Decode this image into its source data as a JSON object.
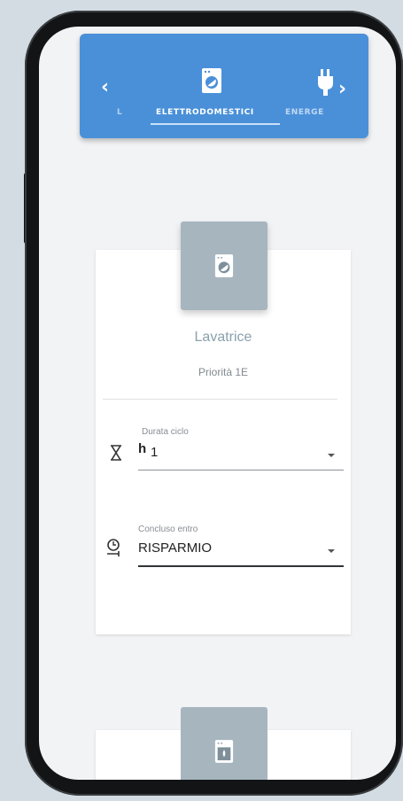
{
  "header": {
    "left_arrow": "‹",
    "right_arrow": "›",
    "tabs": [
      {
        "label": "L"
      },
      {
        "label": "ELETTRODOMESTICI",
        "active": true
      },
      {
        "label": "ENERGE"
      }
    ],
    "active_icon": "washing-machine-icon",
    "right_icon": "plug-icon"
  },
  "appliance": {
    "name": "Lavatrice",
    "priority": "Priorità 1E",
    "icon": "washing-machine-icon"
  },
  "fields": {
    "duration": {
      "label": "Durata ciclo",
      "prefix": "h",
      "value": "1",
      "icon": "hourglass-icon"
    },
    "deadline": {
      "label": "Concluso entro",
      "value": "RISPARMIO",
      "icon": "timer-icon"
    }
  },
  "next_appliance": {
    "icon": "dishwasher-icon"
  },
  "colors": {
    "header": "#4a90d9",
    "tile": "#a7b5bf",
    "name_text": "#8aa1ad"
  }
}
